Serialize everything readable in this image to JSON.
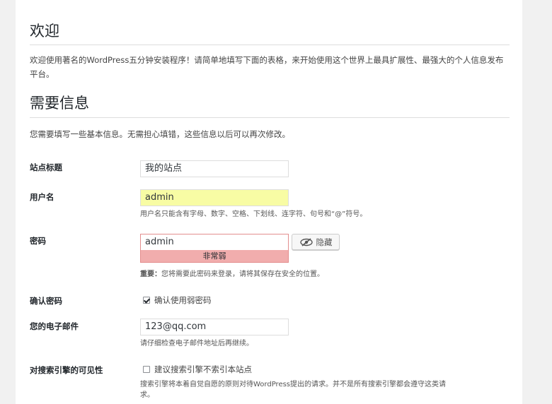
{
  "welcome": {
    "title": "欢迎",
    "intro": "欢迎使用著名的WordPress五分钟安装程序！请简单地填写下面的表格，来开始使用这个世界上最具扩展性、最强大的个人信息发布平台。"
  },
  "required": {
    "title": "需要信息",
    "intro": "您需要填写一些基本信息。无需担心填错，这些信息以后可以再次修改。"
  },
  "form": {
    "site_title": {
      "label": "站点标题",
      "value": "我的站点"
    },
    "username": {
      "label": "用户名",
      "value": "admin",
      "hint": "用户名只能含有字母、数字、空格、下划线、连字符、句号和“@”符号。"
    },
    "password": {
      "label": "密码",
      "value": "admin",
      "strength": "非常弱",
      "hide_label": "隐藏",
      "hint_strong": "重要：",
      "hint": "您将需要此密码来登录，请将其保存在安全的位置。"
    },
    "confirm_password": {
      "label": "确认密码",
      "checkbox_label": "确认使用弱密码",
      "checked": true
    },
    "email": {
      "label": "您的电子邮件",
      "value": "123@qq.com",
      "hint": "请仔细检查电子邮件地址后再继续。"
    },
    "search_visibility": {
      "label": "对搜索引擎的可见性",
      "checkbox_label": "建议搜索引擎不索引本站点",
      "checked": false,
      "hint_line1": "搜索引擎将本着自觉自愿的原则对待WordPress提出的请求。并不是所有搜索引擎都会遵守这类请",
      "hint_line2": "求。"
    }
  },
  "colors": {
    "highlight": "#f8fca4",
    "weak_strength": "#f1adad"
  }
}
